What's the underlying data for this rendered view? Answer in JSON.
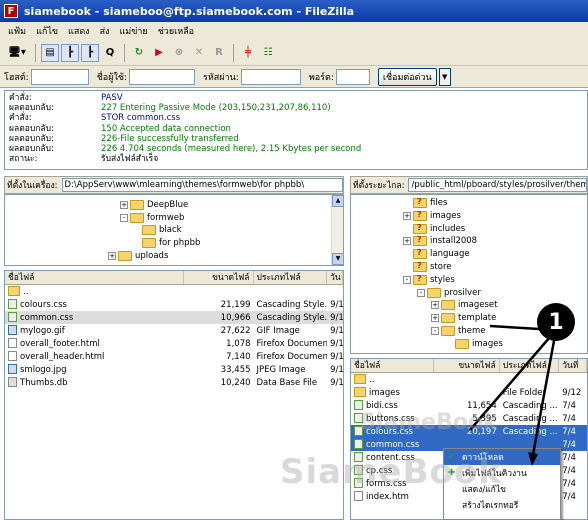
{
  "window": {
    "title": "siamebook - siameboo@ftp.siamebook.com - FileZilla"
  },
  "menu": [
    "แฟ้ม",
    "แก้ไข",
    "แสดง",
    "ส่ง",
    "แม่ข่าย",
    "ช่วยเหลือ"
  ],
  "quickconnect": {
    "host_label": "โฮสต์:",
    "user_label": "ชื่อผู้ใช้:",
    "pass_label": "รหัสผ่าน:",
    "port_label": "พอร์ต:",
    "connect_label": "เชื่อมต่อด่วน",
    "host_value": "",
    "user_value": "",
    "pass_value": "",
    "port_value": ""
  },
  "log": [
    {
      "k": "คำสั่ง:",
      "v": "PASV",
      "c": "#0000c0"
    },
    {
      "k": "ผลตอบกลับ:",
      "v": "227 Entering Passive Mode (203,150,231,207,86,110)",
      "c": "#008000"
    },
    {
      "k": "คำสั่ง:",
      "v": "STOR common.css",
      "c": "#0000c0"
    },
    {
      "k": "ผลตอบกลับ:",
      "v": "150 Accepted data connection",
      "c": "#008000"
    },
    {
      "k": "ผลตอบกลับ:",
      "v": "226-File successfully transferred",
      "c": "#008000"
    },
    {
      "k": "ผลตอบกลับ:",
      "v": "226 4.704 seconds (measured here), 2.15 Kbytes per second",
      "c": "#008000"
    },
    {
      "k": "สถานะ:",
      "v": "รับส่งไฟล์สำเร็จ",
      "c": "#000000"
    }
  ],
  "local": {
    "path_label": "ที่ตั้งในเครื่อง:",
    "path": "D:\\AppServ\\www\\mlearning\\themes\\formweb\\for phpbb\\",
    "tree": [
      {
        "pm": "+",
        "name": "DeepBlue"
      },
      {
        "pm": "-",
        "name": "formweb"
      },
      {
        "pm": "",
        "name": "black"
      },
      {
        "pm": "",
        "name": "for phpbb"
      },
      {
        "pm": "+",
        "name": "uploads"
      }
    ],
    "columns": [
      "ชื่อไฟล์",
      "ขนาดไฟล์",
      "ประเภทไฟล์",
      "วัน"
    ],
    "files": [
      {
        "name": "..",
        "size": "",
        "type": "",
        "date": "",
        "icon": "folder"
      },
      {
        "name": "colours.css",
        "size": "21,199",
        "type": "Cascading Style...",
        "date": "9/1",
        "icon": "css"
      },
      {
        "name": "common.css",
        "size": "10,966",
        "type": "Cascading Style...",
        "date": "9/1",
        "icon": "css"
      },
      {
        "name": "mylogo.gif",
        "size": "27,622",
        "type": "GIF Image",
        "date": "9/1",
        "icon": "img"
      },
      {
        "name": "overall_footer.html",
        "size": "1,078",
        "type": "Firefox Document",
        "date": "9/1",
        "icon": "file"
      },
      {
        "name": "overall_header.html",
        "size": "7,140",
        "type": "Firefox Document",
        "date": "9/1",
        "icon": "file"
      },
      {
        "name": "smlogo.jpg",
        "size": "33,455",
        "type": "JPEG Image",
        "date": "9/1",
        "icon": "img"
      },
      {
        "name": "Thumbs.db",
        "size": "10,240",
        "type": "Data Base File",
        "date": "9/1",
        "icon": "db"
      }
    ]
  },
  "remote": {
    "path_label": "ที่ตั้งระยะไกล:",
    "path": "/public_html/pboard/styles/prosilver/theme",
    "tree": [
      {
        "pm": "",
        "name": "files"
      },
      {
        "pm": "+",
        "name": "images"
      },
      {
        "pm": "",
        "name": "includes"
      },
      {
        "pm": "+",
        "name": "install2008"
      },
      {
        "pm": "",
        "name": "language"
      },
      {
        "pm": "",
        "name": "store"
      },
      {
        "pm": "-",
        "name": "styles"
      },
      {
        "pm": "-",
        "name": "prosilver"
      },
      {
        "pm": "+",
        "name": "imageset"
      },
      {
        "pm": "+",
        "name": "template"
      },
      {
        "pm": "-",
        "name": "theme"
      },
      {
        "pm": "",
        "name": "images"
      }
    ],
    "columns": [
      "ชื่อไฟล์",
      "ขนาดไฟล์",
      "ประเภทไฟล์",
      "วันที่"
    ],
    "files": [
      {
        "name": "..",
        "size": "",
        "type": "",
        "date": "",
        "icon": "folder"
      },
      {
        "name": "images",
        "size": "",
        "type": "File Folder",
        "date": "9/12",
        "icon": "folder"
      },
      {
        "name": "bidi.css",
        "size": "11,654",
        "type": "Cascading ...",
        "date": "7/4",
        "icon": "css"
      },
      {
        "name": "buttons.css",
        "size": "5,395",
        "type": "Cascading ...",
        "date": "7/4",
        "icon": "css"
      },
      {
        "name": "colours.css",
        "size": "20,197",
        "type": "Cascading ...",
        "date": "7/4",
        "icon": "css"
      },
      {
        "name": "common.css",
        "size": "",
        "type": "",
        "date": "7/4",
        "icon": "css"
      },
      {
        "name": "content.css",
        "size": "",
        "type": "",
        "date": "7/4",
        "icon": "css"
      },
      {
        "name": "cp.css",
        "size": "",
        "type": "",
        "date": "7/4",
        "icon": "css"
      },
      {
        "name": "forms.css",
        "size": "",
        "type": "",
        "date": "7/4",
        "icon": "css"
      },
      {
        "name": "index.htm",
        "size": "",
        "type": "",
        "date": "7/4",
        "icon": "file"
      }
    ]
  },
  "context_menu": [
    {
      "label": "ดาวน์โหลด",
      "icon": "download-icon"
    },
    {
      "label": "เพิ่มไฟล์ในคิวงาน",
      "icon": "queue-icon"
    },
    {
      "label": "แสดง/แก้ไข",
      "icon": ""
    },
    {
      "label": "สร้างไดเรกทอรี",
      "icon": ""
    }
  ],
  "callout_number": "1",
  "watermark": "SiameBook"
}
